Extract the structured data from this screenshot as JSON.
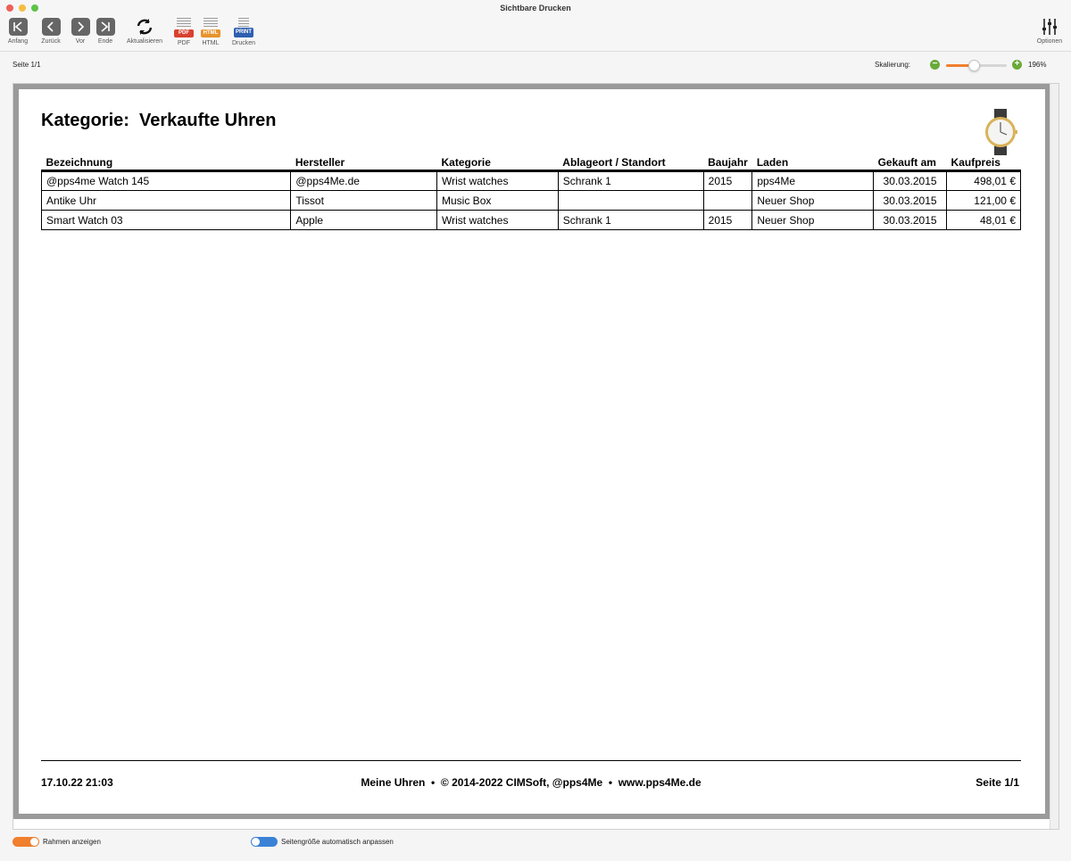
{
  "window": {
    "title": "Sichtbare Drucken"
  },
  "toolbar": {
    "first": "Anfang",
    "back": "Zurück",
    "forward": "Vor",
    "end": "Ende",
    "refresh": "Aktualisieren",
    "pdf": "PDF",
    "html": "HTML",
    "print": "Drucken",
    "options": "Optionen",
    "pdf_badge": "PDF",
    "html_badge": "HTML",
    "print_badge": "PRINT"
  },
  "status": {
    "page_indicator": "Seite  1/1",
    "scale_label": "Skalierung:",
    "zoom_value": "196%",
    "zoom_fraction": 0.45
  },
  "report": {
    "title": "Kategorie:  Verkaufte Uhren",
    "columns": [
      "Bezeichnung",
      "Hersteller",
      "Kategorie",
      "Ablageort / Standort",
      "Baujahr",
      "Laden",
      "Gekauft am",
      "Kaufpreis"
    ],
    "rows": [
      [
        "@pps4me Watch 145",
        "@pps4Me.de",
        "Wrist watches",
        "Schrank 1",
        "2015",
        "pps4Me",
        "30.03.2015",
        "498,01 €"
      ],
      [
        "Antike Uhr",
        "Tissot",
        "Music Box",
        "",
        "",
        "Neuer Shop",
        "30.03.2015",
        "121,00 €"
      ],
      [
        "Smart Watch 03",
        "Apple",
        "Wrist watches",
        "Schrank 1",
        "2015",
        "Neuer Shop",
        "30.03.2015",
        "48,01 €"
      ]
    ],
    "footer_left": "17.10.22 21:03",
    "footer_center": "Meine Uhren  •  © 2014-2022 CIMSoft, @pps4Me  •  www.pps4Me.de",
    "footer_right": "Seite 1/1"
  },
  "bottom": {
    "frame_toggle": "Rahmen anzeigen",
    "autosize_toggle": "Seitengröße automatisch anpassen"
  },
  "colors": {
    "accent_orange": "#f07f2e",
    "toggle_blue": "#3b82d6",
    "zoom_green": "#6aaa3a",
    "pdf_red": "#d9412f",
    "html_orange": "#e8932c",
    "print_blue": "#2f5fb0"
  }
}
